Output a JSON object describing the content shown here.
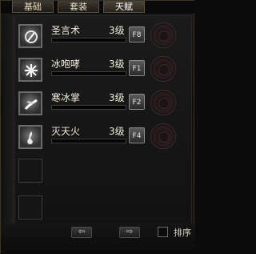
{
  "tabs": [
    {
      "label": "基础",
      "active": false
    },
    {
      "label": "套装",
      "active": false
    },
    {
      "label": "天赋",
      "active": true
    }
  ],
  "skills": [
    {
      "name": "圣言术",
      "level": "3级",
      "key": "F8",
      "icon": "holy-word-icon"
    },
    {
      "name": "冰咆哮",
      "level": "3级",
      "key": "F1",
      "icon": "ice-roar-icon"
    },
    {
      "name": "寒冰掌",
      "level": "3级",
      "key": "F2",
      "icon": "frost-palm-icon"
    },
    {
      "name": "灭天火",
      "level": "3级",
      "key": "F4",
      "icon": "heaven-fire-icon"
    }
  ],
  "empty_slots": 2,
  "footer": {
    "prev_label": "⇦",
    "next_label": "⇨",
    "sort_label": "排序"
  },
  "colors": {
    "background": "#0b0b0b",
    "text": "#f0e9d6",
    "border": "#6a6a6a"
  }
}
